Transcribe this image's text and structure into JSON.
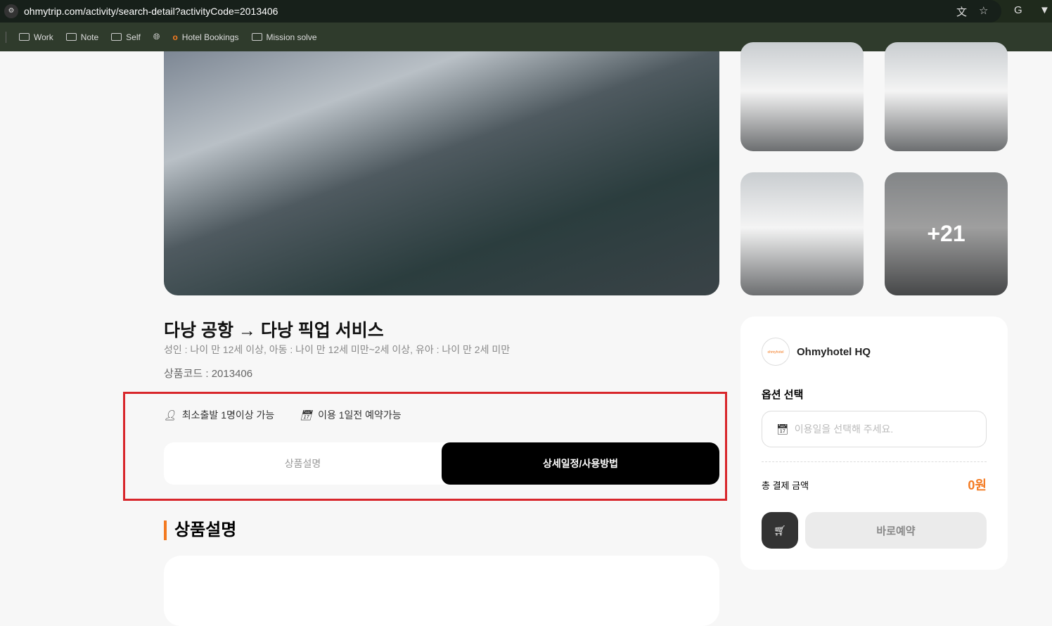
{
  "browser": {
    "url": "ohmytrip.com/activity/search-detail?activityCode=2013406",
    "bookmarks": [
      "Work",
      "Note",
      "Self",
      "Hotel Bookings",
      "Mission solve"
    ]
  },
  "gallery": {
    "more_count": "+21"
  },
  "product": {
    "title": "다낭 공항 → 다낭 픽업 서비스",
    "age_info": "성인 : 나이 만 12세 이상, 아동 : 나이 만 12세 미만~2세 이상, 유아 : 나이 만 2세 미만",
    "code": "상품코드 : 2013406",
    "min_departure": "최소출발 1명이상 가능",
    "booking_notice": "이용 1일전 예약가능"
  },
  "tabs": [
    {
      "label": "상품설명"
    },
    {
      "label": "상세일정/사용방법"
    }
  ],
  "section_title": "상품설명",
  "booking": {
    "seller": "Ohmyhotel HQ",
    "option_label": "옵션 선택",
    "date_placeholder": "이용일을 선택해 주세요.",
    "total_label": "총 결제 금액",
    "total_value": "0원",
    "book_label": "바로예약"
  },
  "colors": {
    "accent": "#f37a21",
    "highlight": "#d8262b"
  }
}
